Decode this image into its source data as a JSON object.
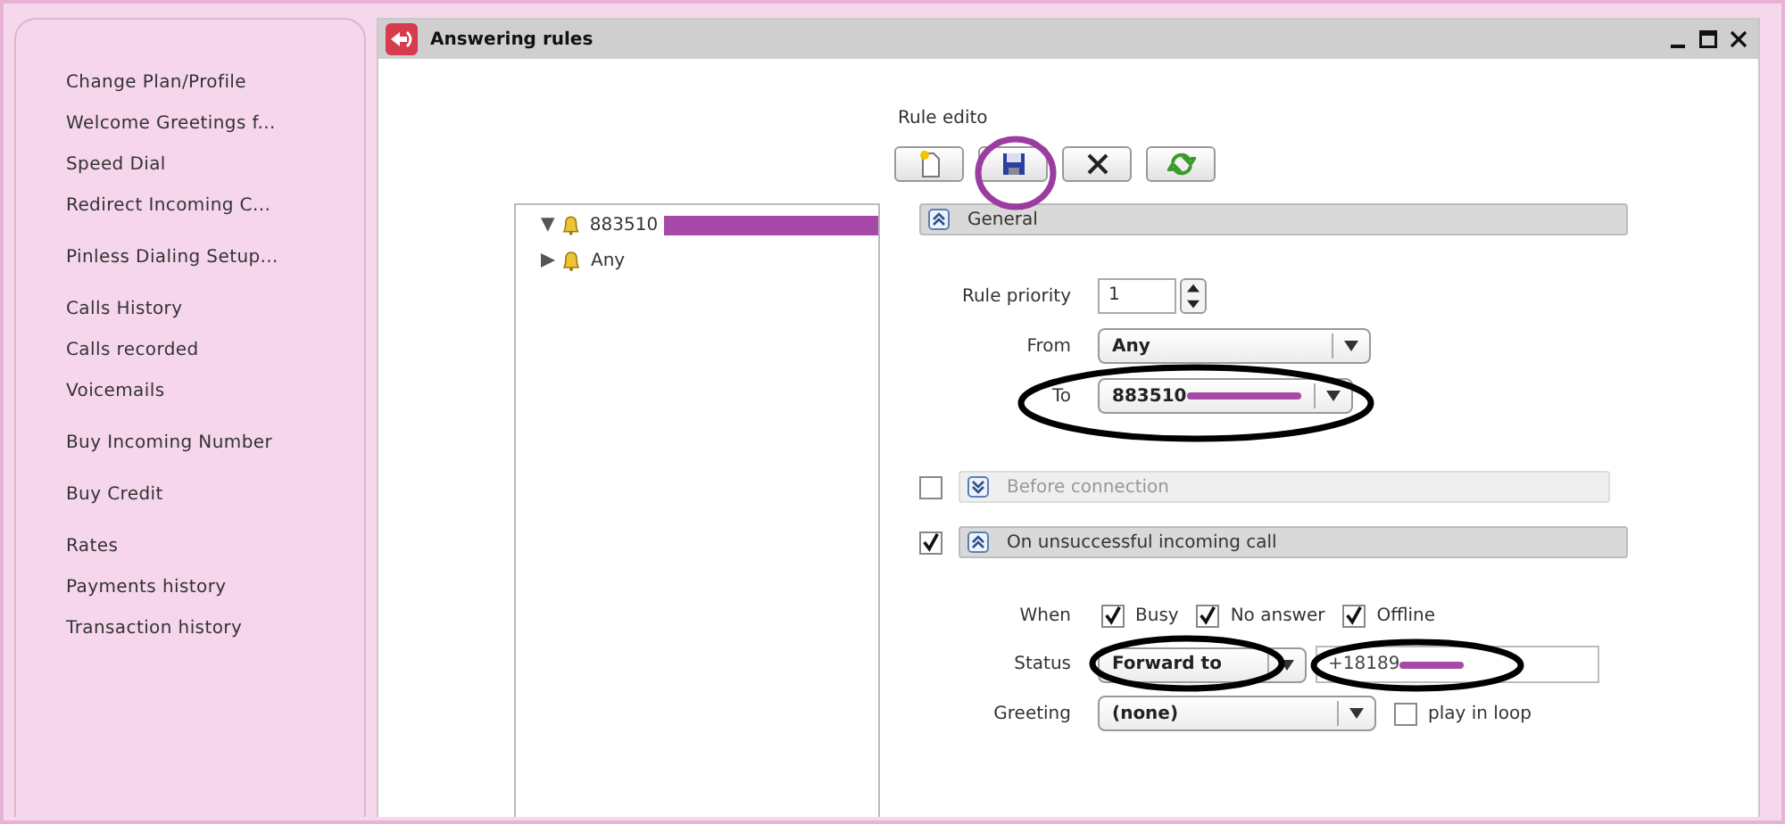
{
  "sidebar": {
    "groups": [
      [
        "Change Plan/Profile",
        "Welcome Greetings f...",
        "Speed Dial",
        "Redirect Incoming C..."
      ],
      [
        "Pinless Dialing Setup..."
      ],
      [
        "Calls History",
        "Calls recorded",
        "Voicemails"
      ],
      [
        "Buy Incoming Number"
      ],
      [
        "Buy Credit"
      ],
      [
        "Rates",
        "Payments history",
        "Transaction history"
      ]
    ]
  },
  "window": {
    "title": "Answering rules"
  },
  "tree": [
    {
      "label": "883510",
      "expanded": true,
      "redacted": true
    },
    {
      "label": "Any",
      "expanded": false,
      "redacted": false
    }
  ],
  "editor": {
    "title": "Rule edito",
    "sections": [
      {
        "kind": "general",
        "title": "General",
        "expanded": true
      },
      {
        "kind": "before",
        "title": "Before connection",
        "expanded": false,
        "checked": false,
        "disabled": true
      },
      {
        "kind": "unsuccessful",
        "title": "On unsuccessful incoming call",
        "expanded": true,
        "checked": true,
        "disabled": false
      }
    ],
    "priority": {
      "label": "Rule priority",
      "value": "1"
    },
    "from": {
      "label": "From",
      "value": "Any"
    },
    "to": {
      "label": "To",
      "value": "883510"
    },
    "when": {
      "label": "When",
      "options": [
        {
          "label": "Busy",
          "checked": true
        },
        {
          "label": "No answer",
          "checked": true
        },
        {
          "label": "Offline",
          "checked": true
        }
      ]
    },
    "status": {
      "label": "Status",
      "value": "Forward to",
      "number": "+18189"
    },
    "greeting": {
      "label": "Greeting",
      "value": "(none)",
      "loop": {
        "label": "play in loop",
        "checked": false
      }
    }
  }
}
